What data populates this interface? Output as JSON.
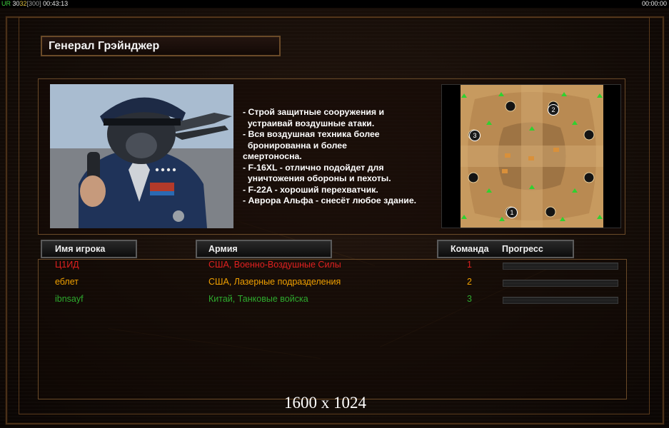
{
  "status_bar": {
    "ur": "UR",
    "v1": "30",
    "v2": "32",
    "v3": "[300]",
    "time_left": "00:43:13",
    "time_right": "00:00:00"
  },
  "general": {
    "title": "Генерал Грэйнджер"
  },
  "description": [
    "- Строй защитные сооружения и",
    "  устраивай воздушные атаки.",
    "- Вся воздушная техника более",
    "  бронированна и более",
    "смертоносна.",
    "- F-16XL - отлично подойдет для",
    "  уничтожения обороны и пехоты.",
    "- F-22A - хороший перехватчик.",
    "- Аврора Альфа - снесёт любое здание."
  ],
  "minimap": {
    "start_labels": [
      "1",
      "2",
      "3"
    ]
  },
  "headers": {
    "player_name": "Имя игрока",
    "army": "Армия",
    "team": "Команда",
    "progress": "Прогресс"
  },
  "players": [
    {
      "name": "Ц1ИД",
      "army": "США, Военно-Воздушные Силы",
      "team": "1",
      "color": "#e02020",
      "progress": 0
    },
    {
      "name": "еблет",
      "army": "США, Лазерные подразделения",
      "team": "2",
      "color": "#f0a000",
      "progress": 0
    },
    {
      "name": "ibnsayf",
      "army": "Китай, Танковые войска",
      "team": "3",
      "color": "#2eaa2e",
      "progress": 0
    }
  ],
  "resolution_label": "1600 x 1024"
}
